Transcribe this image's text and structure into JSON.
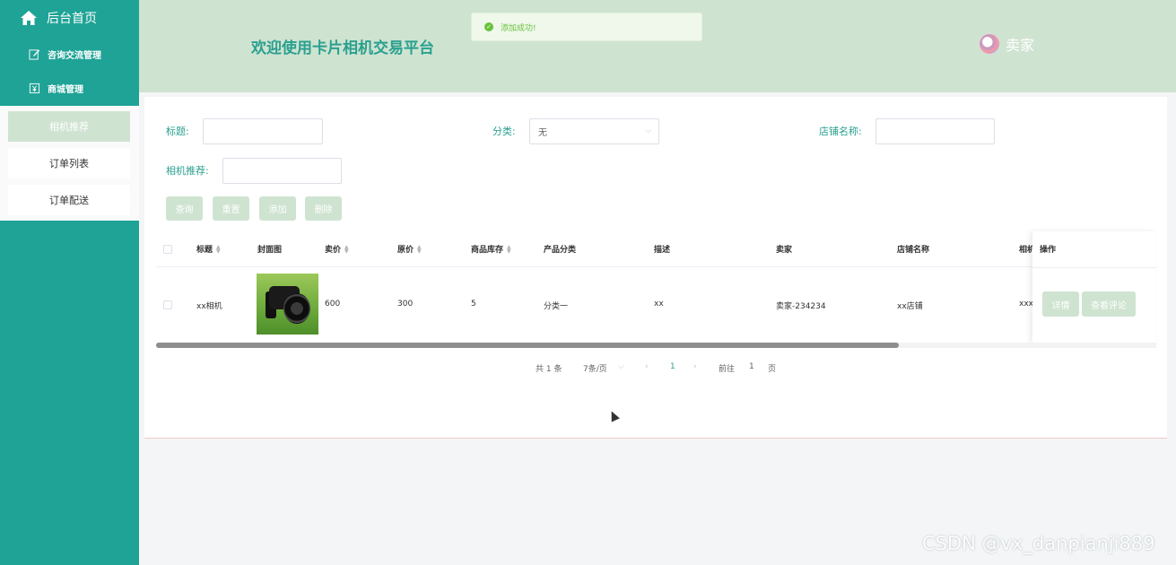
{
  "sidebar": {
    "home_label": "后台首页",
    "menus": [
      {
        "label": "咨询交流管理",
        "icon": "edit-icon"
      },
      {
        "label": "商城管理",
        "icon": "shop-icon"
      }
    ],
    "sub_items": [
      {
        "label": "相机推荐",
        "active": true
      },
      {
        "label": "订单列表",
        "active": false
      },
      {
        "label": "订单配送",
        "active": false
      }
    ]
  },
  "header": {
    "title": "欢迎使用卡片相机交易平台",
    "user": "卖家"
  },
  "toast": {
    "message": "添加成功!"
  },
  "search": {
    "title_label": "标题:",
    "title_value": "",
    "category_label": "分类:",
    "category_value": "无",
    "shop_label": "店铺名称:",
    "shop_value": "",
    "recommend_label": "相机推荐:",
    "recommend_value": ""
  },
  "actions": {
    "query": "查询",
    "reset": "重置",
    "add": "添加",
    "delete": "删除"
  },
  "table": {
    "columns": [
      "标题",
      "封面图",
      "卖价",
      "原价",
      "商品库存",
      "产品分类",
      "描述",
      "卖家",
      "店铺名称",
      "相机"
    ],
    "ops_header": "操作",
    "rows": [
      {
        "title": "xx相机",
        "sell_price": "600",
        "original_price": "300",
        "stock": "5",
        "category": "分类一",
        "description": "xx",
        "seller": "卖家-234234",
        "shop": "xx店铺",
        "camera": "xxx",
        "detail_btn": "详情",
        "comment_btn": "查看评论"
      }
    ]
  },
  "pagination": {
    "total": "共 1 条",
    "page_size": "7条/页",
    "current": "1",
    "goto_label": "前往",
    "goto_value": "1",
    "page_suffix": "页"
  },
  "watermark": "CSDN @vx_danpianji889",
  "colors": {
    "sidebar": "#1fa396",
    "header": "#cfe3d1",
    "accent": "#2aa08f",
    "button": "#cfe3d1",
    "success": "#67c23a"
  }
}
